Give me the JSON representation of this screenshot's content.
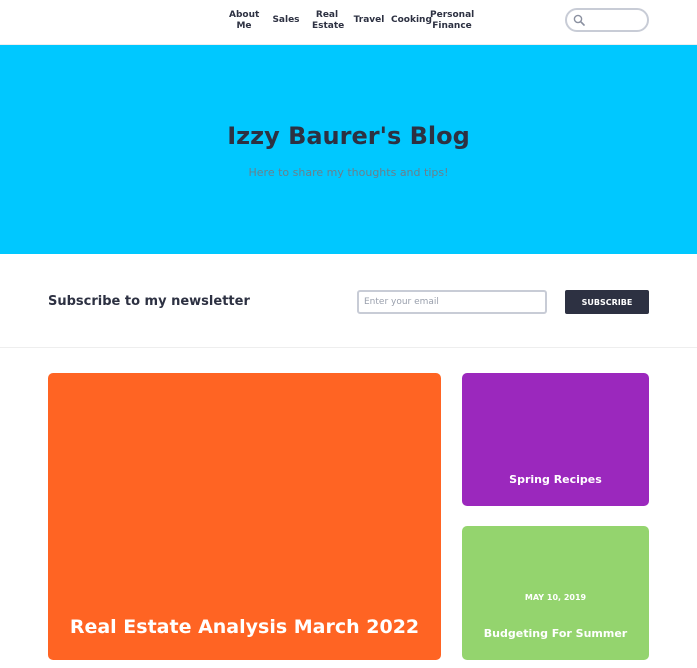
{
  "nav": {
    "items": [
      {
        "line1": "About",
        "line2": "Me"
      },
      {
        "line1": "Sales",
        "line2": ""
      },
      {
        "line1": "Real",
        "line2": "Estate"
      },
      {
        "line1": "Travel",
        "line2": ""
      },
      {
        "line1": "Cooking",
        "line2": ""
      },
      {
        "line1": "Personal",
        "line2": "Finance"
      }
    ]
  },
  "hero": {
    "title": "Izzy Baurer's Blog",
    "subtitle": "Here to share my thoughts and tips!"
  },
  "newsletter": {
    "label": "Subscribe to my newsletter",
    "placeholder": "Enter your email",
    "button": "SUBSCRIBE"
  },
  "posts": [
    {
      "title": "Real Estate Analysis March 2022",
      "date": "",
      "color": "#ff6423"
    },
    {
      "title": "Spring Recipes",
      "date": "",
      "color": "#9b28bd"
    },
    {
      "title": "Budgeting For Summer",
      "date": "MAY 10, 2019",
      "color": "#94d46e"
    }
  ],
  "colors": {
    "hero_bg": "#00c8ff",
    "text_dark": "#2d3142",
    "button_bg": "#2d3142"
  },
  "icons": {
    "search": "search-icon"
  }
}
